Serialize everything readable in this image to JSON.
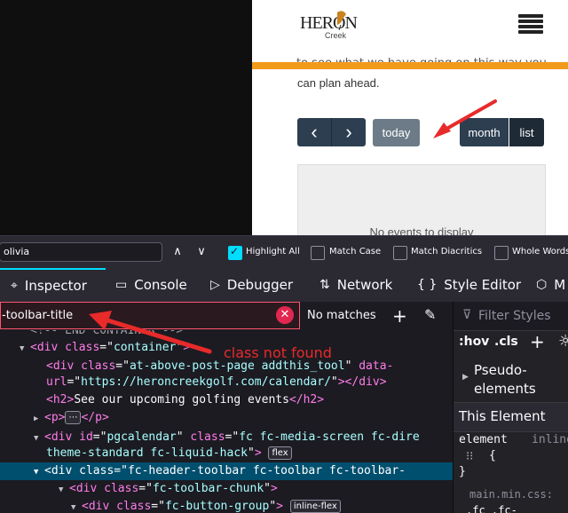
{
  "page": {
    "logo_main": "HERON",
    "logo_sub": "Creek",
    "cut_text": "to see what we have going on this way you",
    "intro_text": "can plan ahead.",
    "prev_icon": "‹",
    "next_icon": "›",
    "today_label": "today",
    "month_label": "month",
    "list_label": "list",
    "no_events": "No events to display",
    "accent_color": "#f29a1a",
    "button_color": "#2c3e50"
  },
  "findbar": {
    "query": "olivia",
    "up_icon": "∧",
    "down_icon": "∨",
    "options": [
      {
        "label": "Highlight All",
        "checked": true
      },
      {
        "label": "Match Case",
        "checked": false
      },
      {
        "label": "Match Diacritics",
        "checked": false
      },
      {
        "label": "Whole Words",
        "checked": false
      }
    ]
  },
  "tabs": [
    {
      "label": "Inspector",
      "icon": "inspector-icon",
      "glyph": "⌖",
      "active": true
    },
    {
      "label": "Console",
      "icon": "console-icon",
      "glyph": "▭",
      "active": false
    },
    {
      "label": "Debugger",
      "icon": "debugger-icon",
      "glyph": "▷",
      "active": false
    },
    {
      "label": "Network",
      "icon": "network-icon",
      "glyph": "⇅",
      "active": false
    },
    {
      "label": "Style Editor",
      "icon": "style-editor-icon",
      "glyph": "{ }",
      "active": false
    },
    {
      "label": "M",
      "icon": "memory-icon",
      "glyph": "⬡",
      "active": false
    }
  ],
  "inspector": {
    "search_value": "-toolbar-title",
    "status": "No matches",
    "annotation": "class not found"
  },
  "markup": {
    "line0": "<!-- END CONTAINER -->",
    "line1_tag": "div",
    "line1_attr": "class",
    "line1_val": "container",
    "line2_tag": "div",
    "line2_attr": "class",
    "line2_val": "at-above-post-page addthis_tool",
    "line2_attr2": "data-",
    "line3_cont": "url",
    "line3_val": "https://heroncreekgolf.com/calendar/",
    "line4_text": "See our upcoming golfing events",
    "line5_badge": "⋯",
    "line6_tag": "div",
    "line6_attr": "id",
    "line6_val": "pgcalendar",
    "line6_attr2": "class",
    "line6_val2": "fc fc-media-screen fc-dire",
    "line7_cont": "theme-standard fc-liquid-hack",
    "line7_badge": "flex",
    "line8_tag": "div",
    "line8_attr": "class",
    "line8_val": "fc-header-toolbar fc-toolbar fc-toolbar-",
    "line9_tag": "div",
    "line9_attr": "class",
    "line9_val": "fc-toolbar-chunk",
    "line10_tag": "div",
    "line10_attr": "class",
    "line10_val": "fc-button-group",
    "line10_badge": "inline-flex"
  },
  "styles": {
    "filter_placeholder": "Filter Styles",
    "hov": ":hov",
    "cls": ".cls",
    "pseudo": "Pseudo-elements",
    "this_element": "This Element",
    "rule_selector": "element",
    "rule_inline": "inline",
    "brace_open": "{",
    "brace_close": "}",
    "source": "main.min.css:",
    "next_selector": ".fc .fc-"
  }
}
